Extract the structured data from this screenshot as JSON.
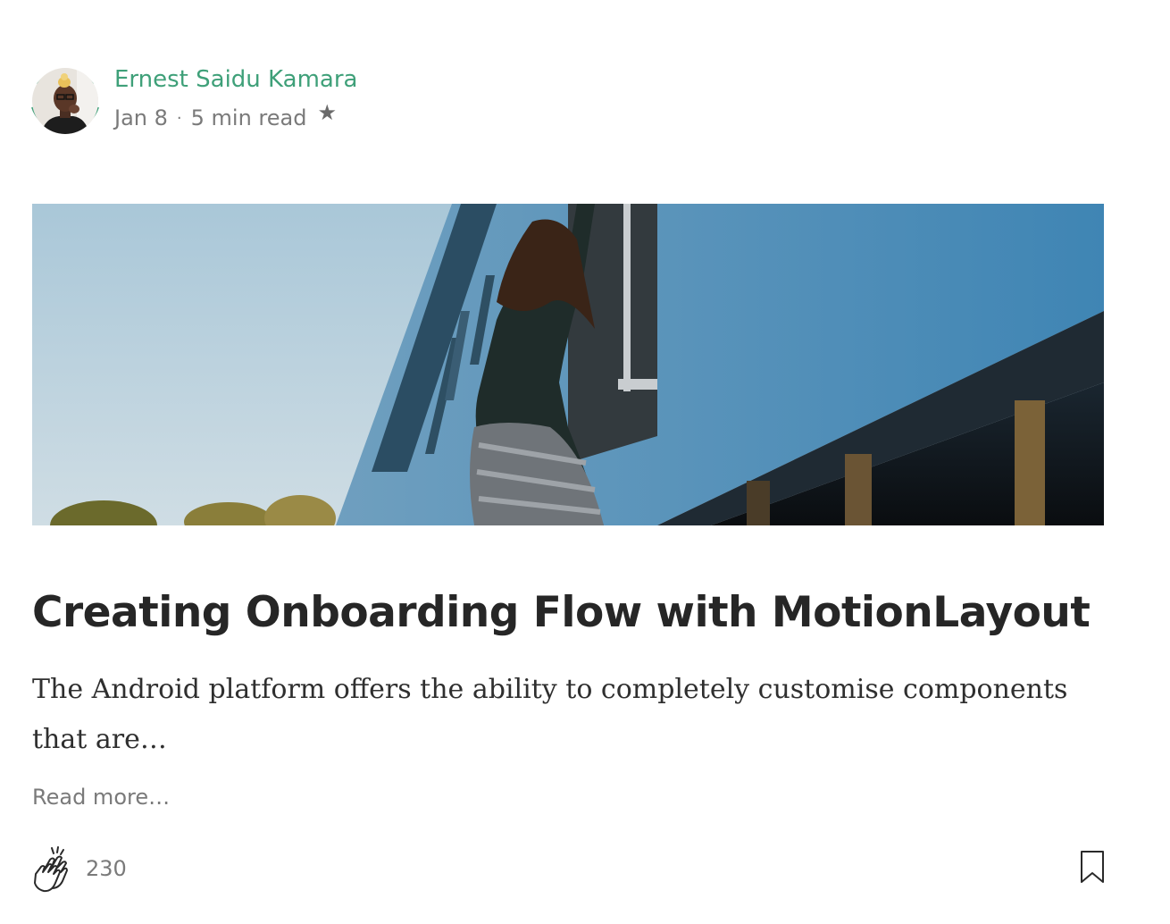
{
  "author": {
    "name": "Ernest Saidu Kamara",
    "avatar_icon": "author-avatar",
    "ring_color": "#3fa079"
  },
  "meta": {
    "date": "Jan 8",
    "separator": "·",
    "read_time": "5 min read",
    "star_glyph": "★"
  },
  "hero": {
    "icon": "hero-image-train"
  },
  "post": {
    "title": "Creating Onboarding Flow with MotionLayout",
    "excerpt": "The Android platform offers the ability to completely customise components that are…",
    "read_more": "Read more…"
  },
  "footer": {
    "clap_count": "230",
    "clap_icon": "clap-icon",
    "bookmark_icon": "bookmark-icon"
  },
  "colors": {
    "accent": "#3fa079",
    "muted": "#7a7a7a",
    "text": "#262626"
  }
}
